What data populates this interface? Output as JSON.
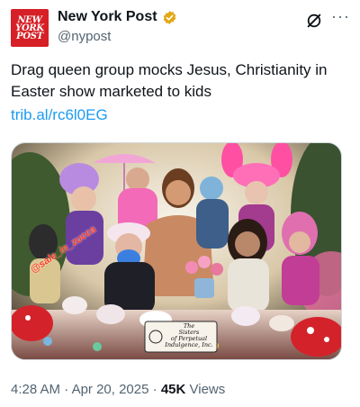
{
  "account": {
    "logo_lines": [
      "NEW",
      "YORK",
      "POST"
    ],
    "name": "New York Post",
    "handle": "@nypost",
    "verified_color": "#e2a815"
  },
  "header_icons": [
    "grok-icon",
    "more-icon"
  ],
  "tweet": {
    "text": "Drag queen group mocks Jesus, Christianity in Easter show marketed to kids",
    "link": "trib.al/rc6l0EG"
  },
  "media": {
    "watermark": "@sale_in_zucca",
    "sign_lines": [
      "The",
      "Sisters",
      "of Perpetual",
      "Indulgence, Inc."
    ]
  },
  "meta": {
    "time": "4:28 AM",
    "sep1": " · ",
    "date": "Apr 20, 2025",
    "sep2": " · ",
    "views_count": "45K",
    "views_label": " Views"
  },
  "colors": {
    "accent_link": "#1d9bf0",
    "brand_red": "#d61f26",
    "secondary_text": "#536471"
  }
}
